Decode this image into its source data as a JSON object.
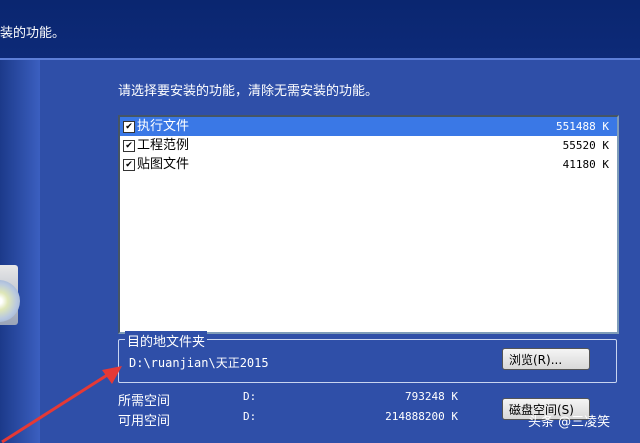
{
  "header": {
    "text": "装的功能。"
  },
  "instruction": "请选择要安装的功能，清除无需安装的功能。",
  "features": [
    {
      "name": "执行文件",
      "size": "551488 K",
      "checked": true,
      "selected": true
    },
    {
      "name": "工程范例",
      "size": "55520 K",
      "checked": true,
      "selected": false
    },
    {
      "name": "贴图文件",
      "size": "41180 K",
      "checked": true,
      "selected": false
    }
  ],
  "destination": {
    "legend": "目的地文件夹",
    "path": "D:\\ruanjian\\天正2015",
    "browse_label": "浏览(R)..."
  },
  "space": {
    "required": {
      "label": "所需空间",
      "drive": "D:",
      "value": "793248 K"
    },
    "available": {
      "label": "可用空间",
      "drive": "D:",
      "value": "214888200 K"
    },
    "disk_button_label": "磁盘空间(S)"
  },
  "watermark": "头条 @三凌笑",
  "colors": {
    "background": "#2f4fa8",
    "selection": "#3a78e6",
    "arrow": "#e53935"
  }
}
